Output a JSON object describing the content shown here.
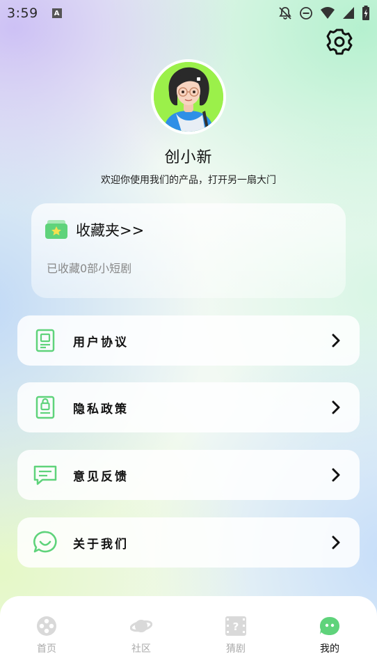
{
  "status_bar": {
    "time": "3:59",
    "notification_glyph": "A"
  },
  "profile": {
    "username": "创小新",
    "tagline": "欢迎你使用我们的产品，打开另一扇大门"
  },
  "favorites": {
    "title": "收藏夹>>",
    "count_text": "已收藏0部小短剧"
  },
  "menu": [
    {
      "label": "用户协议",
      "icon": "document-icon"
    },
    {
      "label": "隐私政策",
      "icon": "lock-document-icon"
    },
    {
      "label": "意见反馈",
      "icon": "message-icon"
    },
    {
      "label": "关于我们",
      "icon": "chat-smile-icon"
    }
  ],
  "tabs": [
    {
      "label": "首页",
      "icon": "film-reel-icon",
      "active": false
    },
    {
      "label": "社区",
      "icon": "planet-icon",
      "active": false
    },
    {
      "label": "猜剧",
      "icon": "question-film-icon",
      "active": false
    },
    {
      "label": "我的",
      "icon": "face-icon",
      "active": true
    }
  ],
  "colors": {
    "accent_green": "#5fd37b",
    "inactive_gray": "#d9d9d9",
    "text_dark": "#111111"
  }
}
